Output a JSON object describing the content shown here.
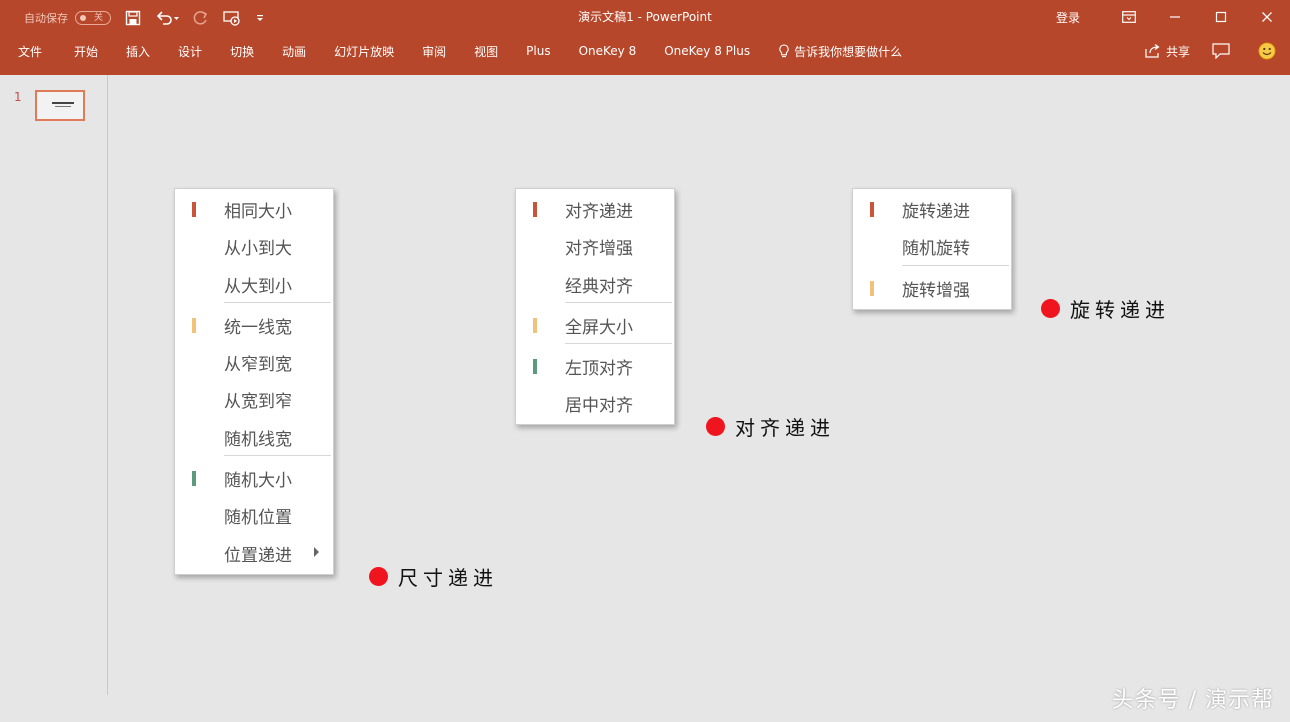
{
  "window": {
    "autosave_label": "自动保存",
    "autosave_state": "关",
    "title": "演示文稿1  -  PowerPoint",
    "login": "登录"
  },
  "ribbon": {
    "tabs": [
      "文件",
      "开始",
      "插入",
      "设计",
      "切换",
      "动画",
      "幻灯片放映",
      "审阅",
      "视图",
      "Plus",
      "OneKey 8",
      "OneKey 8 Plus"
    ],
    "tell_me": "告诉我你想要做什么",
    "share": "共享"
  },
  "slide_panel": {
    "slide_number": "1"
  },
  "menus": {
    "size": {
      "items": [
        {
          "label": "相同大小",
          "mark": "#c8553a"
        },
        {
          "label": "从小到大",
          "mark": ""
        },
        {
          "label": "从大到小",
          "mark": ""
        },
        {
          "label": "统一线宽",
          "mark": "#f2c27a"
        },
        {
          "label": "从窄到宽",
          "mark": ""
        },
        {
          "label": "从宽到窄",
          "mark": ""
        },
        {
          "label": "随机线宽",
          "mark": ""
        },
        {
          "label": "随机大小",
          "mark": "#5b9a7d"
        },
        {
          "label": "随机位置",
          "mark": ""
        },
        {
          "label": "位置递进",
          "mark": "",
          "submenu": true
        }
      ]
    },
    "align": {
      "items": [
        {
          "label": "对齐递进",
          "mark": "#c8553a"
        },
        {
          "label": "对齐增强",
          "mark": ""
        },
        {
          "label": "经典对齐",
          "mark": ""
        },
        {
          "label": "全屏大小",
          "mark": "#f2c27a"
        },
        {
          "label": "左顶对齐",
          "mark": "#5b9a7d"
        },
        {
          "label": "居中对齐",
          "mark": ""
        }
      ]
    },
    "rotate": {
      "items": [
        {
          "label": "旋转递进",
          "mark": "#c8553a"
        },
        {
          "label": "随机旋转",
          "mark": ""
        },
        {
          "label": "旋转增强",
          "mark": "#f2c27a"
        }
      ]
    }
  },
  "annotations": {
    "size": "尺寸递进",
    "align": "对齐递进",
    "rotate": "旋转递进"
  },
  "watermark": "头条号 / 演示帮",
  "colors": {
    "ribbon": "#b7472a",
    "mark_red": "#c8553a",
    "mark_yellow": "#f2c27a",
    "mark_green": "#5b9a7d",
    "dot": "#f0141e"
  }
}
